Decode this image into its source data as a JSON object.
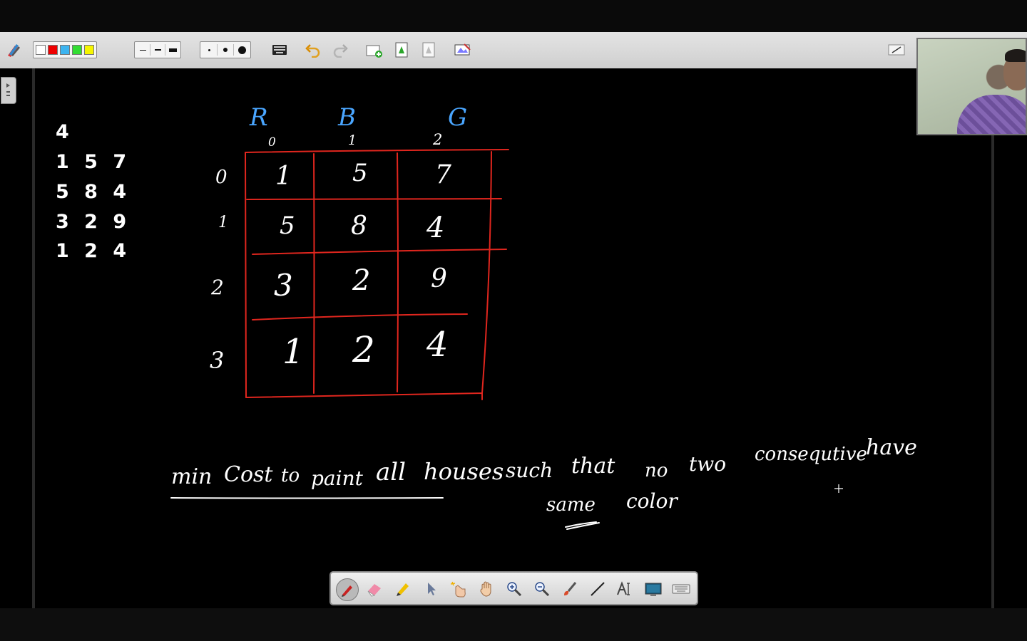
{
  "typed_input": {
    "lines": [
      "4",
      "1 5 7",
      "5 8 4",
      "3 2 9",
      "1 2 4"
    ]
  },
  "table": {
    "column_headers": [
      "R",
      "B",
      "G"
    ],
    "column_indices": [
      "0",
      "1",
      "2"
    ],
    "row_indices": [
      "0",
      "1",
      "2",
      "3"
    ],
    "rows": [
      [
        "1",
        "5",
        "7"
      ],
      [
        "5",
        "8",
        "4"
      ],
      [
        "3",
        "2",
        "9"
      ],
      [
        "1",
        "2",
        "4"
      ]
    ]
  },
  "problem": {
    "line1_words": [
      "min",
      "Cost",
      "to",
      "paint",
      "all",
      "houses",
      "such",
      "that",
      "no",
      "two",
      "consequtive",
      "have"
    ],
    "line2_words": [
      "same",
      "color"
    ]
  },
  "colors": {
    "ink": "#ffffff",
    "grid": "#e0261e",
    "header": "#4aa6ff",
    "toolbar": "#d9d9d9"
  },
  "toolbar_icons": [
    "pen-settings-icon",
    "color-palette",
    "line-width-group",
    "dot-size-group",
    "keyboard-icon",
    "undo-icon",
    "redo-icon",
    "add-page-icon",
    "next-page-icon",
    "prev-page-icon",
    "screenshot-icon",
    "minimize-icon"
  ],
  "dock_icons": [
    "pen-icon",
    "eraser-icon",
    "highlighter-icon",
    "pointer-icon",
    "magic-pointer-icon",
    "hand-icon",
    "zoom-in-icon",
    "zoom-out-icon",
    "brush-icon",
    "line-icon",
    "text-icon",
    "whiteboard-icon",
    "keyboard-icon"
  ]
}
